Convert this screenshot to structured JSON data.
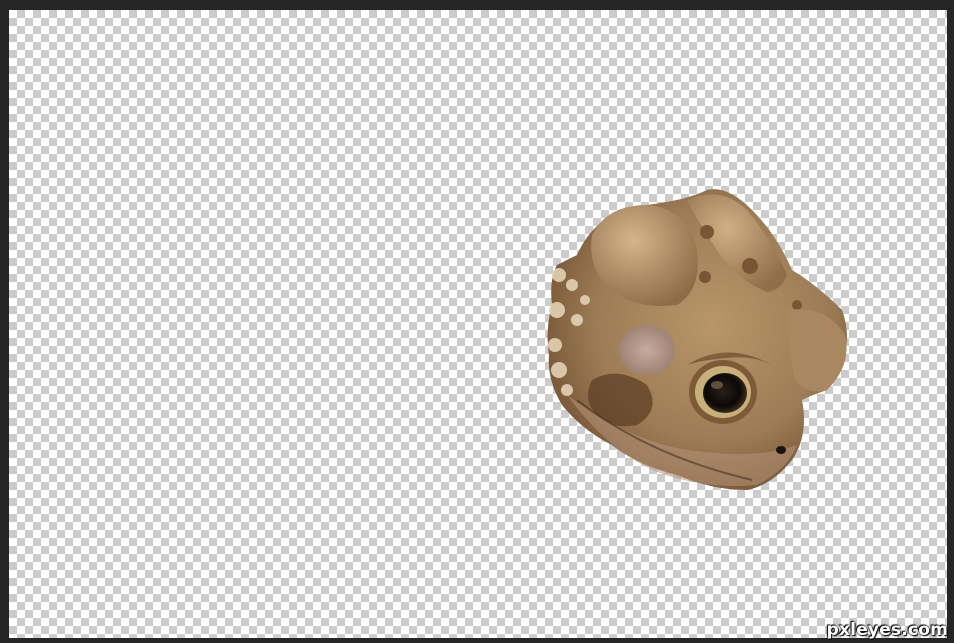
{
  "canvas": {
    "background": "transparency-checkerboard",
    "checker_colors": [
      "#ffffff",
      "#cccccc"
    ]
  },
  "layer": {
    "subject": "toad-head-cutout",
    "colors": {
      "skin": "#9c7c55",
      "skin_light": "#c8a77a",
      "skin_dark": "#6b4a2e",
      "eye_ring": "#c9b07a",
      "pupil": "#111111"
    }
  },
  "watermark": {
    "text": "pxleyes.com"
  }
}
